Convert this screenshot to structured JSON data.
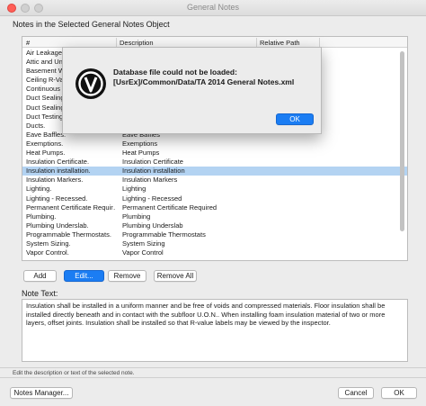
{
  "window": {
    "title": "General Notes"
  },
  "list_section": {
    "label": "Notes in the Selected General Notes Object",
    "columns": [
      "#",
      "Description",
      "Relative Path"
    ],
    "rows": [
      {
        "name": "Air Leakage",
        "description": ""
      },
      {
        "name": "Attic and Unh",
        "description": ""
      },
      {
        "name": "Basement W",
        "description": ""
      },
      {
        "name": "Ceiling R-Va",
        "description": ""
      },
      {
        "name": "Continuous",
        "description": ""
      },
      {
        "name": "Duct Sealing",
        "description": ""
      },
      {
        "name": "Duct Sealing",
        "description": ""
      },
      {
        "name": "Duct Testing",
        "description": ""
      },
      {
        "name": "Ducts.",
        "description": ""
      },
      {
        "name": "Eave Baffles.",
        "description": "Eave Baffles"
      },
      {
        "name": "Exemptions.",
        "description": "Exemptions"
      },
      {
        "name": "Heat Pumps.",
        "description": "Heat Pumps"
      },
      {
        "name": "Insulation Certificate.",
        "description": "Insulation Certificate"
      },
      {
        "name": "Insulation installation.",
        "description": "Insulation installation"
      },
      {
        "name": "Insulation Markers.",
        "description": "Insulation Markers"
      },
      {
        "name": "Lighting.",
        "description": "Lighting"
      },
      {
        "name": "Lighting - Recessed.",
        "description": "Lighting - Recessed"
      },
      {
        "name": "Permanent Certificate Requir…",
        "description": "Permanent Certificate Required"
      },
      {
        "name": "Plumbing.",
        "description": "Plumbing"
      },
      {
        "name": "Plumbing Underslab.",
        "description": "Plumbing Underslab"
      },
      {
        "name": "Programmable Thermostats.",
        "description": "Programmable Thermostats"
      },
      {
        "name": "System Sizing.",
        "description": "System Sizing"
      },
      {
        "name": "Vapor Control.",
        "description": "Vapor Control"
      }
    ],
    "selected_index": 13
  },
  "buttons": {
    "add": "Add",
    "edit": "Edit...",
    "remove": "Remove",
    "remove_all": "Remove All"
  },
  "note": {
    "label": "Note Text:",
    "text": "Insulation shall be installed in a uniform manner and be free of voids and compressed materials. Floor insulation shall be installed directly beneath and in contact with the subfloor U.O.N.. When installing foam insulation material of two or more layers, offset joints. Insulation shall be installed so that R-value labels may be viewed by the inspector."
  },
  "status": {
    "text": "Edit the description or text of the selected note."
  },
  "footer": {
    "notes_manager": "Notes Manager...",
    "cancel": "Cancel",
    "ok": "OK"
  },
  "alert": {
    "message_line1": "Database file could not be loaded:",
    "message_line2": "[UsrEx]/Common/Data/TA 2014 General Notes.xml",
    "ok": "OK",
    "icon": "vectorworks-logo-icon"
  },
  "colors": {
    "accent": "#1b7df3",
    "selection": "#b3d3f2"
  }
}
